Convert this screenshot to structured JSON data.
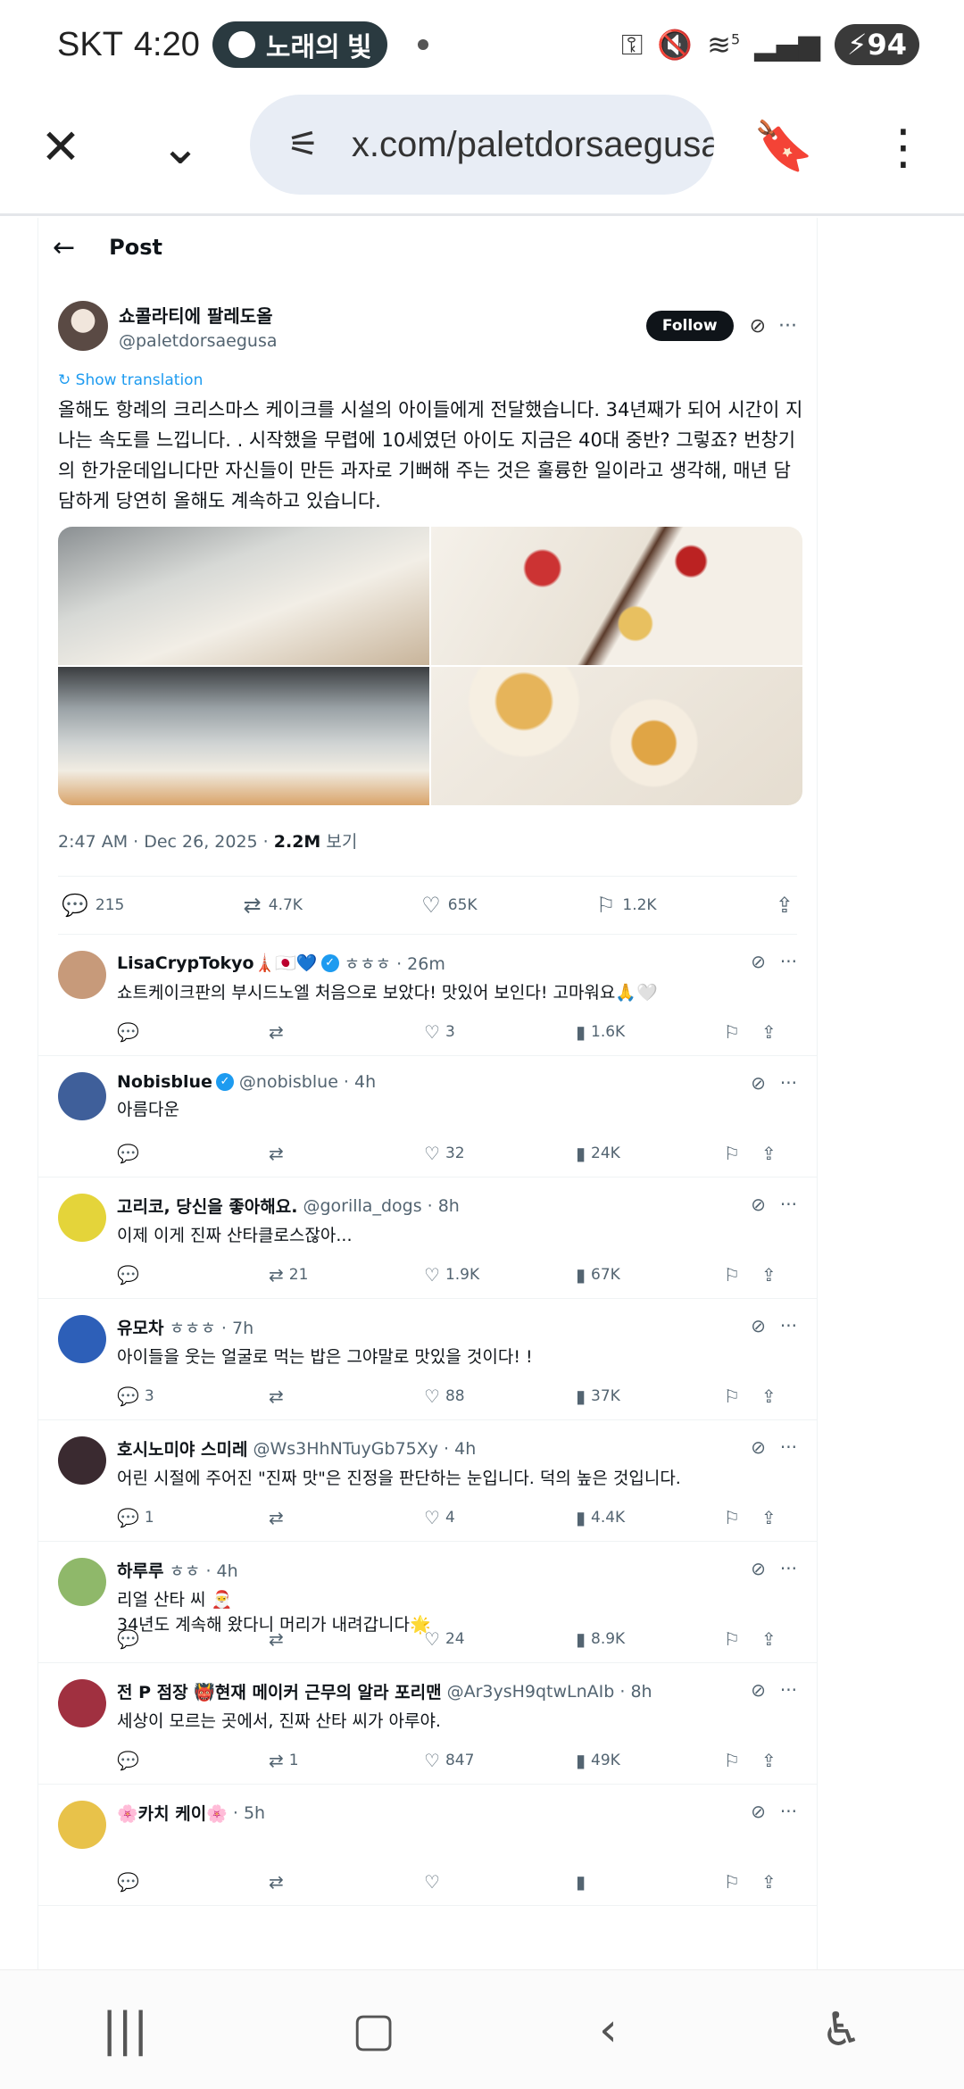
{
  "status_bar": {
    "carrier": "SKT",
    "time": "4:20",
    "media": "노래의 빛",
    "battery": "94",
    "network": "5"
  },
  "browser": {
    "url": "x.com/paletdorsaegusa"
  },
  "header": {
    "title": "Post"
  },
  "post": {
    "display_name": "쇼콜라티에 팔레도올",
    "handle": "@paletdorsaegusa",
    "follow_label": "Follow",
    "translate_label": "Show translation",
    "text": "올해도 항례의 크리스마스 케이크를 시설의 아이들에게 전달했습니다. 34년째가 되어 시간이 지나는 속도를 느낍니다. . 시작했을 무렵에 10세였던 아이도 지금은 40대 중반? 그렇죠? 번창기의 한가운데입니다만 자신들이 만든 과자로 기뻐해 주는 것은 훌륭한 일이라고 생각해, 매년 담담하게 당연히 올해도 계속하고 있습니다.",
    "timestamp": "2:47 AM · Dec 26, 2025 · ",
    "views": "2.2M",
    "views_label": " 보기",
    "replies": "215",
    "reposts": "4.7K",
    "likes": "65K",
    "bookmarks": "1.2K"
  },
  "replies": [
    {
      "name": "LisaCrypTokyo🗼🇯🇵💙",
      "verified": true,
      "handle": "ㅎㅎㅎ · 26m",
      "text": "쇼트케이크판의 부시드노엘 처음으로 보았다! 맛있어 보인다! 고마워요🙏🤍",
      "replies": "",
      "reposts": "",
      "likes": "3",
      "views": "1.6K",
      "avatar": "#c79a7a"
    },
    {
      "name": "Nobisblue",
      "verified": true,
      "handle": "@nobisblue · 4h",
      "text": "아름다운",
      "replies": "",
      "reposts": "",
      "likes": "32",
      "views": "24K",
      "avatar": "#3f5f9a"
    },
    {
      "name": "고리코, 당신을 좋아해요.",
      "verified": false,
      "handle": "@gorilla_dogs · 8h",
      "text": "이제 이게 진짜 산타클로스잖아...",
      "replies": "",
      "reposts": "21",
      "likes": "1.9K",
      "views": "67K",
      "avatar": "#e4d43a"
    },
    {
      "name": "유모차",
      "verified": false,
      "handle": "ㅎㅎㅎ · 7h",
      "text": "아이들을 웃는 얼굴로 먹는 밥은 그야말로 맛있을 것이다! !",
      "replies": "3",
      "reposts": "",
      "likes": "88",
      "views": "37K",
      "avatar": "#2d5fb8"
    },
    {
      "name": "호시노미야 스미레",
      "verified": false,
      "handle": "@Ws3HhNTuyGb75Xy · 4h",
      "text": "어린 시절에 주어진 \"진짜 맛\"은 진정을 판단하는 눈입니다. 덕의 높은 것입니다.",
      "replies": "1",
      "reposts": "",
      "likes": "4",
      "views": "4.4K",
      "avatar": "#3a2a30"
    },
    {
      "name": "하루루",
      "verified": false,
      "handle": "ㅎㅎ · 4h",
      "text": "리얼 산타 씨 🎅\n34년도 계속해 왔다니 머리가 내려갑니다🌟",
      "replies": "",
      "reposts": "",
      "likes": "24",
      "views": "8.9K",
      "avatar": "#8fb86a"
    },
    {
      "name": "전 P 점장 👹현재 메이커 근무의 알라 포리맨",
      "verified": false,
      "handle": "@Ar3ysH9qtwLnAIb · 8h",
      "text": "세상이 모르는 곳에서, 진짜 산타 씨가 아루야.",
      "replies": "",
      "reposts": "1",
      "likes": "847",
      "views": "49K",
      "avatar": "#a03040"
    },
    {
      "name": "🌸카치 케이🌸",
      "verified": false,
      "handle": "· 5h",
      "text": "",
      "replies": "",
      "reposts": "",
      "likes": "",
      "views": "",
      "avatar": "#e8c24a"
    }
  ]
}
